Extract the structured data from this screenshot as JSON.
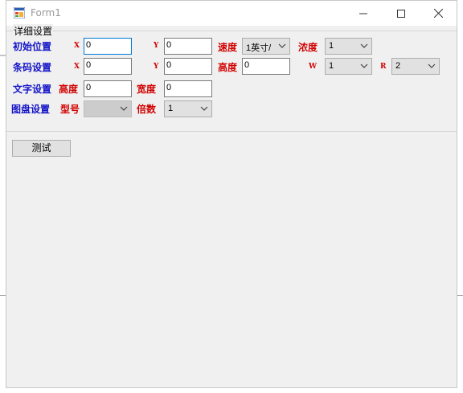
{
  "window": {
    "title": "Form1"
  },
  "group": {
    "title": "详细设置"
  },
  "rows": {
    "initial_position": {
      "label": "初始位置",
      "x_label": "X",
      "x_value": "0",
      "y_label": "Y",
      "y_value": "0",
      "speed_label": "速度",
      "speed_value": "1英寸/",
      "density_label": "浓度",
      "density_value": "1"
    },
    "barcode": {
      "label": "条码设置",
      "x_label": "X",
      "x_value": "0",
      "y_label": "Y",
      "y_value": "0",
      "height_label": "高度",
      "height_value": "0",
      "w_label": "W",
      "w_value": "1",
      "r_label": "R",
      "r_value": "2"
    },
    "text": {
      "label": "文字设置",
      "height_label": "高度",
      "height_value": "0",
      "width_label": "宽度",
      "width_value": "0"
    },
    "graphic": {
      "label": "图盘设置",
      "model_label": "型号",
      "model_value": "",
      "multiplier_label": "倍数",
      "multiplier_value": "1"
    }
  },
  "test_button": {
    "label": "测试"
  },
  "colors": {
    "blue_label": "#1414c8",
    "red_label": "#d20000",
    "focus_border": "#0078d7"
  }
}
